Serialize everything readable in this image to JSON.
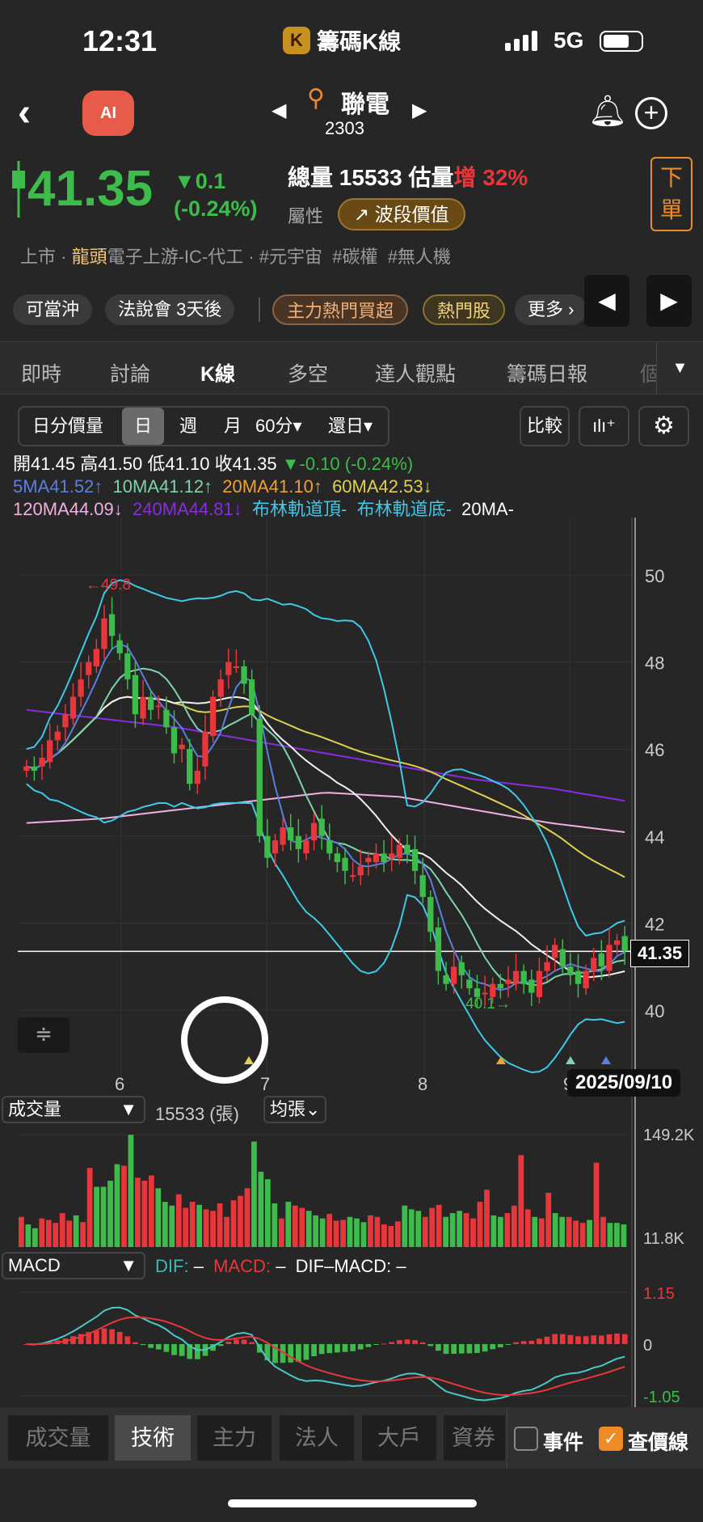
{
  "status": {
    "time": "12:31",
    "app_title": "籌碼K線",
    "app_logo": "K",
    "network": "5G"
  },
  "header": {
    "stock_name": "聯電",
    "stock_code": "2303",
    "ai_label": "AI"
  },
  "quote": {
    "price": "41.35",
    "change": "▼0.1",
    "change_pct": "(-0.24%)",
    "volume_label": "總量",
    "volume": "15533",
    "est_label": "估量",
    "est_dir": "增",
    "est_pct": "32%",
    "attr_label": "屬性",
    "wave_btn": "波段價值",
    "order_btn": "下單",
    "tags": [
      "上市 · ",
      "龍頭",
      "電子上游-IC-代工 · #元宇宙  #碳權  #無人機"
    ]
  },
  "chips": [
    "可當沖",
    "法說會 3天後",
    "主力熱門買超",
    "熱門股",
    "更多 ›"
  ],
  "tabs": [
    "即時",
    "討論",
    "K線",
    "多空",
    "達人觀點",
    "籌碼日報",
    "個"
  ],
  "toolbar": {
    "items": [
      "日分價量",
      "日",
      "週",
      "月",
      "60分▾",
      "還日▾"
    ],
    "compare": "比較"
  },
  "ohlc": {
    "open": "開41.45",
    "high": "高41.50",
    "low": "低41.10",
    "close": "收41.35",
    "chg": "▼-0.10 (-0.24%)",
    "ma": [
      "5MA41.52↑",
      "10MA41.12↑",
      "20MA41.10↑",
      "60MA42.53↓",
      "120MA44.09↓",
      "240MA44.81↓",
      "布林軌道頂-",
      "布林軌道底-",
      "20MA-"
    ]
  },
  "colors": {
    "up": "#e8363a",
    "down": "#3dbb4b",
    "ma5": "#5b7fe0",
    "ma10": "#7fd3a8",
    "ma20": "#f0f0f0",
    "ma60": "#e0d050",
    "ma120": "#f0b0e0",
    "ma240": "#8a2be2",
    "boll": "#3fc8e8",
    "accent": "#f08a24"
  },
  "chart_data": {
    "type": "candlestick",
    "y_ticks": [
      "50",
      "48",
      "46",
      "44",
      "42",
      "40"
    ],
    "ylim": [
      39,
      51
    ],
    "x_ticks": [
      "6",
      "7",
      "8",
      "9"
    ],
    "last_price_label": "41.35",
    "date_label": "2025/09/10",
    "max_label": "←49.8",
    "min_label": "40.1→",
    "closes": [
      45.6,
      45.5,
      45.8,
      46.2,
      46.4,
      46.8,
      47.2,
      47.6,
      48.0,
      48.3,
      49.0,
      48.6,
      48.2,
      47.6,
      46.8,
      47.2,
      46.9,
      47.0,
      46.5,
      45.9,
      46.1,
      45.2,
      45.5,
      46.4,
      47.2,
      47.6,
      48.0,
      47.9,
      47.5,
      46.8,
      44.0,
      43.5,
      43.9,
      44.2,
      43.9,
      43.7,
      43.9,
      44.3,
      44.0,
      43.6,
      43.4,
      43.2,
      43.1,
      43.3,
      43.5,
      43.6,
      43.4,
      43.6,
      43.8,
      43.6,
      43.2,
      42.6,
      41.8,
      40.9,
      40.6,
      41.0,
      40.8,
      40.5,
      40.3,
      40.4,
      40.6,
      40.5,
      40.7,
      40.9,
      40.6,
      40.4,
      40.9,
      41.1,
      41.5,
      41.0,
      40.8,
      40.6,
      40.9,
      41.2,
      41.0,
      41.5,
      41.6,
      41.35
    ],
    "ma120": [
      44.3,
      44.4,
      44.6,
      44.8,
      45.0,
      44.9,
      44.6,
      44.3,
      44.09
    ],
    "ma240": [
      46.9,
      46.7,
      46.5,
      46.2,
      45.9,
      45.6,
      45.3,
      45.1,
      44.81
    ],
    "volume": {
      "selector": "成交量",
      "value": "15533 (張)",
      "unit_btn": "均張⌄",
      "max_label": "149.2K",
      "min_label": "11.8K",
      "values": [
        40,
        30,
        25,
        38,
        36,
        32,
        45,
        35,
        42,
        33,
        105,
        80,
        80,
        88,
        110,
        108,
        149,
        92,
        88,
        95,
        78,
        60,
        55,
        70,
        52,
        60,
        56,
        50,
        48,
        58,
        40,
        62,
        68,
        78,
        140,
        100,
        90,
        58,
        38,
        60,
        55,
        52,
        48,
        42,
        38,
        44,
        35,
        36,
        40,
        38,
        33,
        42,
        40,
        30,
        28,
        34,
        55,
        50,
        48,
        40,
        52,
        56,
        40,
        45,
        48,
        45,
        38,
        60,
        76,
        42,
        40,
        45,
        55,
        122,
        50,
        40,
        38,
        72,
        45,
        40,
        40,
        35,
        32,
        36,
        112,
        40,
        32,
        32,
        30
      ],
      "up_flags": [
        1,
        0,
        0,
        1,
        1,
        1,
        1,
        1,
        0,
        1,
        1,
        0,
        0,
        0,
        0,
        1,
        0,
        1,
        1,
        1,
        0,
        0,
        0,
        1,
        1,
        1,
        0,
        1,
        1,
        1,
        1,
        1,
        1,
        1,
        0,
        0,
        0,
        0,
        1,
        0,
        1,
        1,
        0,
        0,
        0,
        1,
        1,
        1,
        0,
        0,
        0,
        1,
        1,
        1,
        1,
        1,
        0,
        0,
        0,
        1,
        1,
        1,
        0,
        0,
        0,
        1,
        1,
        1,
        1,
        0,
        0,
        1,
        1,
        1,
        1,
        0,
        1,
        1,
        0,
        0,
        1,
        1,
        1,
        0,
        1,
        1,
        0,
        0,
        0
      ]
    },
    "macd": {
      "selector": "MACD",
      "dif": "DIF:",
      "dif_val": "–",
      "macd": "MACD:",
      "macd_val": "–",
      "osc": "DIF–MACD:",
      "osc_val": "–",
      "ticks": [
        "1.15",
        "0",
        "-1.05"
      ]
    }
  },
  "bottom_tabs": [
    "成交量",
    "技術",
    "主力",
    "法人",
    "大戶",
    "資券"
  ],
  "checks": [
    {
      "label": "事件",
      "checked": false
    },
    {
      "label": "查價線",
      "checked": true
    }
  ]
}
